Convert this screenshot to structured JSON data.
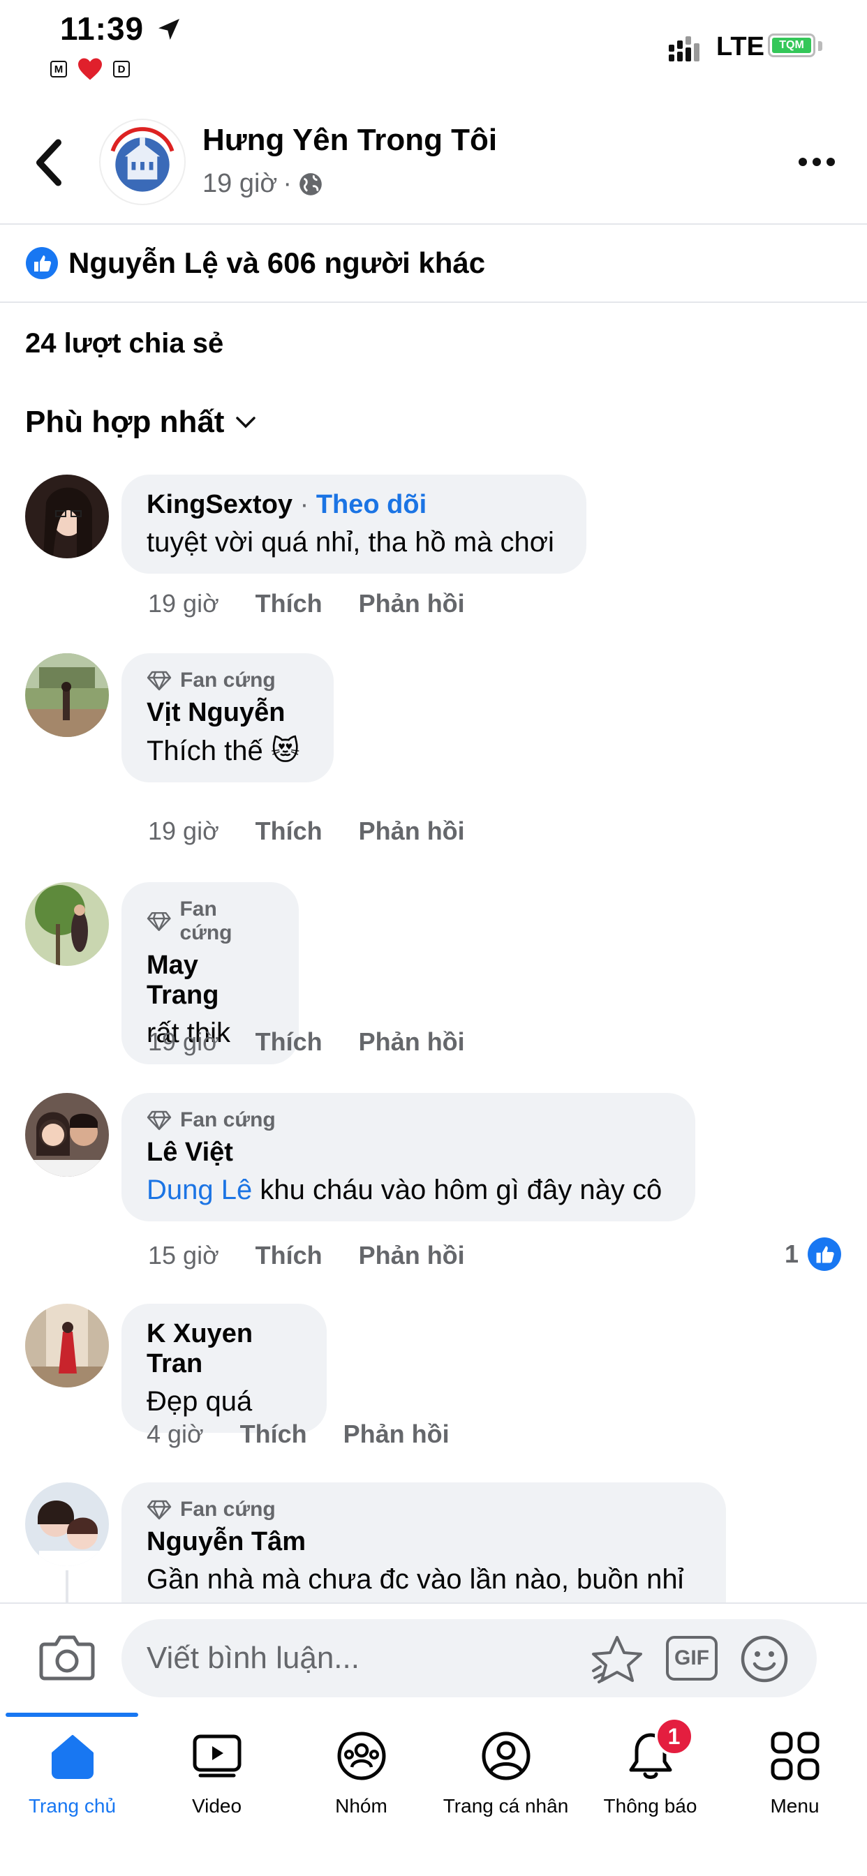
{
  "status_bar": {
    "time": "11:39",
    "network": "LTE",
    "battery_label": "TQM",
    "mini_left": "M",
    "mini_right": "D"
  },
  "header": {
    "page_name": "Hưng Yên Trong Tôi",
    "time_ago": "19 giờ",
    "dot": "·"
  },
  "reactions": {
    "summary": "Nguyễn Lệ  và 606 người khác"
  },
  "shares": "24 lượt chia sẻ",
  "sort": {
    "label": "Phù hợp nhất"
  },
  "labels": {
    "like": "Thích",
    "reply": "Phản hồi",
    "fan_badge": "Fan cứng",
    "follow": "Theo dõi",
    "dot": "·"
  },
  "comments": [
    {
      "name": "KingSextoy",
      "text": "tuyệt vời quá nhỉ, tha hồ mà chơi",
      "time": "19 giờ"
    },
    {
      "name": "Vịt Nguyễn",
      "text": "Thích thế 😻",
      "time": "19 giờ"
    },
    {
      "name": "May Trang",
      "text": "rất thik",
      "time": "19 giờ"
    },
    {
      "name": "Lê Việt",
      "mention": "Dung Lê",
      "text": " khu cháu vào hôm gì đây này cô",
      "time": "15 giờ",
      "likes": "1"
    },
    {
      "name": "K Xuyen Tran",
      "text": "Đẹp quá",
      "time": "4 giờ"
    },
    {
      "name": "Nguyễn Tâm",
      "text": "Gần nhà mà chưa đc vào lần nào, buồn nhỉ"
    }
  ],
  "composer": {
    "placeholder": "Viết bình luận...",
    "gif_label": "GIF"
  },
  "tabs": [
    {
      "label": "Trang chủ",
      "icon": "home-icon"
    },
    {
      "label": "Video",
      "icon": "video-icon"
    },
    {
      "label": "Nhóm",
      "icon": "groups-icon"
    },
    {
      "label": "Trang cá nhân",
      "icon": "profile-icon"
    },
    {
      "label": "Thông báo",
      "icon": "bell-icon",
      "badge": "1"
    },
    {
      "label": "Menu",
      "icon": "menu-grid-icon"
    }
  ],
  "colors": {
    "accent": "#1877f2",
    "link": "#1b74e4",
    "bubble": "#f0f2f5",
    "muted": "#65676b",
    "badge": "#e41e3f"
  }
}
